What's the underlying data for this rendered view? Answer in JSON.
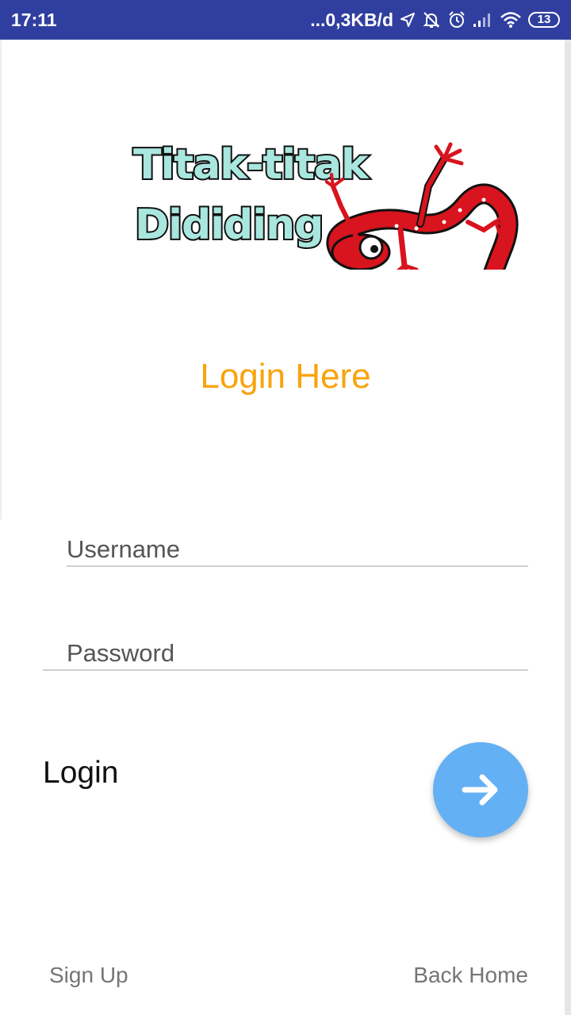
{
  "status_bar": {
    "time": "17:11",
    "network_speed": "...0,3KB/d",
    "battery": "13",
    "icons": [
      "location-icon",
      "muted-bell-icon",
      "alarm-icon",
      "signal-icon",
      "wifi-icon",
      "battery-icon"
    ]
  },
  "logo": {
    "line1": "Titak-titak",
    "line2": "Dididing",
    "colors": {
      "text_fill": "#a8e6de",
      "lizard": "#d8141e"
    }
  },
  "title": "Login Here",
  "form": {
    "username_placeholder": "Username",
    "password_placeholder": "Password",
    "username_value": "",
    "password_value": ""
  },
  "login_label": "Login",
  "fab_icon": "arrow-right-icon",
  "footer": {
    "sign_up": "Sign Up",
    "back_home": "Back Home"
  },
  "colors": {
    "status_bar": "#303f9f",
    "title": "#f9a30b",
    "fab": "#64b0f4",
    "link": "#757575"
  }
}
